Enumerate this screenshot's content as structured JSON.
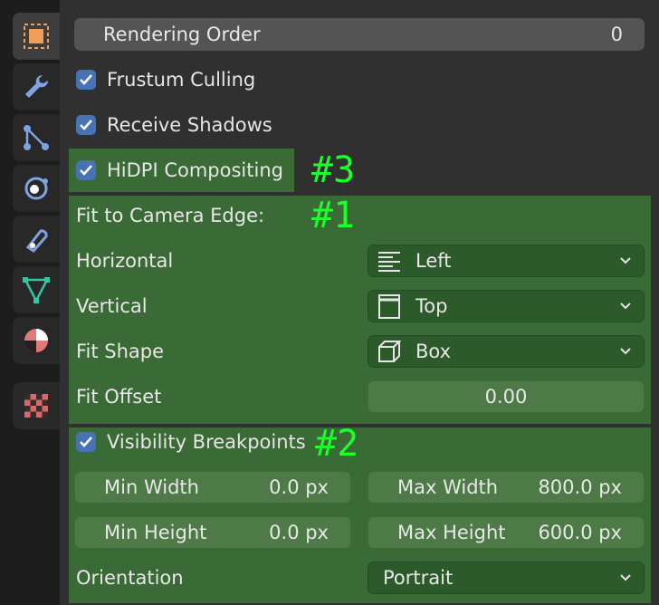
{
  "tabs": [
    {
      "name": "object-tab",
      "icon": "object-square-icon",
      "active": true,
      "color": "#f0a05a"
    },
    {
      "name": "modifier-tab",
      "icon": "wrench-icon",
      "color": "#7ea3e0"
    },
    {
      "name": "particles-tab",
      "icon": "particles-icon",
      "color": "#7ea3e0"
    },
    {
      "name": "physics-tab",
      "icon": "physics-orbit-icon",
      "color": "#7ea3e0"
    },
    {
      "name": "constraints-tab",
      "icon": "constraint-icon",
      "color": "#7ea3e0"
    },
    {
      "name": "data-tab",
      "icon": "mesh-triangle-icon",
      "color": "#30c6a4"
    },
    {
      "name": "material-tab",
      "icon": "material-sphere-icon",
      "color": "#e07a7a"
    },
    {
      "name": "texture-tab",
      "icon": "checker-texture-icon",
      "color": "#d46a6a"
    }
  ],
  "rendering_order": {
    "label": "Rendering Order",
    "value": "0"
  },
  "checkboxes": {
    "frustum": {
      "label": "Frustum Culling",
      "checked": true
    },
    "shadows": {
      "label": "Receive Shadows",
      "checked": true
    },
    "hidpi": {
      "label": "HiDPI Compositing",
      "checked": true
    },
    "visibility": {
      "label": "Visibility Breakpoints",
      "checked": true
    }
  },
  "annotations": {
    "a3": "#3",
    "a1": "#1",
    "a2": "#2"
  },
  "fit": {
    "title": "Fit to Camera Edge:",
    "horizontal": {
      "label": "Horizontal",
      "value": "Left",
      "icon": "align-left-icon"
    },
    "vertical": {
      "label": "Vertical",
      "value": "Top",
      "icon": "align-top-icon"
    },
    "shape": {
      "label": "Fit Shape",
      "value": "Box",
      "icon": "cube-icon"
    },
    "offset": {
      "label": "Fit Offset",
      "value": "0.00"
    }
  },
  "breakpoints": {
    "min_width": {
      "label": "Min Width",
      "value": "0.0 px"
    },
    "max_width": {
      "label": "Max Width",
      "value": "800.0 px"
    },
    "min_height": {
      "label": "Min Height",
      "value": "0.0 px"
    },
    "max_height": {
      "label": "Max Height",
      "value": "600.0 px"
    },
    "orientation": {
      "label": "Orientation",
      "value": "Portrait"
    }
  },
  "colors": {
    "highlight": "#3a6a35",
    "annotation": "#1dff2d",
    "checkbox": "#4772b3"
  }
}
